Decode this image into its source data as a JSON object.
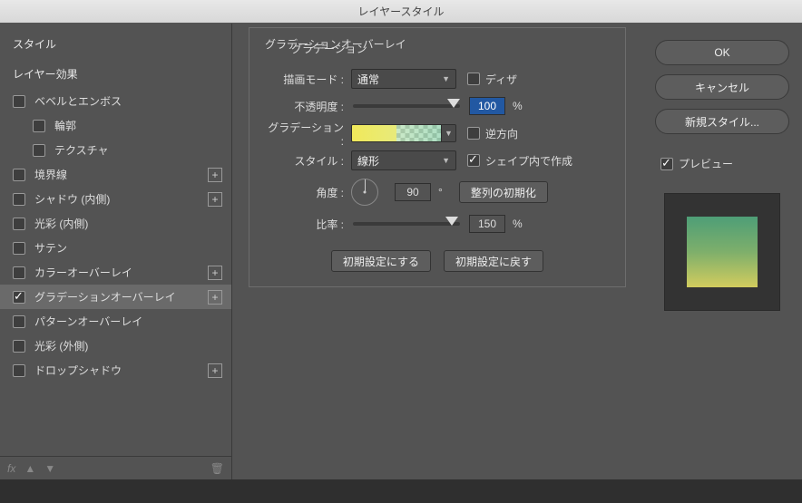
{
  "title": "レイヤースタイル",
  "left": {
    "styles_header": "スタイル",
    "effects_header": "レイヤー効果",
    "items": [
      {
        "label": "ベベルとエンボス",
        "checked": false,
        "plus": false,
        "sub": false,
        "selected": false
      },
      {
        "label": "輪郭",
        "checked": false,
        "plus": false,
        "sub": true,
        "selected": false
      },
      {
        "label": "テクスチャ",
        "checked": false,
        "plus": false,
        "sub": true,
        "selected": false
      },
      {
        "label": "境界線",
        "checked": false,
        "plus": true,
        "sub": false,
        "selected": false
      },
      {
        "label": "シャドウ (内側)",
        "checked": false,
        "plus": true,
        "sub": false,
        "selected": false
      },
      {
        "label": "光彩 (内側)",
        "checked": false,
        "plus": false,
        "sub": false,
        "selected": false
      },
      {
        "label": "サテン",
        "checked": false,
        "plus": false,
        "sub": false,
        "selected": false
      },
      {
        "label": "カラーオーバーレイ",
        "checked": false,
        "plus": true,
        "sub": false,
        "selected": false
      },
      {
        "label": "グラデーションオーバーレイ",
        "checked": true,
        "plus": true,
        "sub": false,
        "selected": true
      },
      {
        "label": "パターンオーバーレイ",
        "checked": false,
        "plus": false,
        "sub": false,
        "selected": false
      },
      {
        "label": "光彩 (外側)",
        "checked": false,
        "plus": false,
        "sub": false,
        "selected": false
      },
      {
        "label": "ドロップシャドウ",
        "checked": false,
        "plus": true,
        "sub": false,
        "selected": false
      }
    ],
    "footer_fx": "fx"
  },
  "center": {
    "title": "グラデーションオーバーレイ",
    "subtitle": "グラデーション",
    "blend_label": "描画モード :",
    "blend_value": "通常",
    "dither_label": "ディザ",
    "opacity_label": "不透明度 :",
    "opacity_value": "100",
    "opacity_unit": "%",
    "gradient_label": "グラデーション :",
    "reverse_label": "逆方向",
    "style_label": "スタイル :",
    "style_value": "線形",
    "shape_align_label": "シェイプ内で作成",
    "angle_label": "角度 :",
    "angle_value": "90",
    "angle_unit": "°",
    "align_reset": "整列の初期化",
    "scale_label": "比率 :",
    "scale_value": "150",
    "scale_unit": "%",
    "make_default": "初期設定にする",
    "reset_default": "初期設定に戻す"
  },
  "right": {
    "ok": "OK",
    "cancel": "キャンセル",
    "new_style": "新規スタイル...",
    "preview": "プレビュー"
  }
}
